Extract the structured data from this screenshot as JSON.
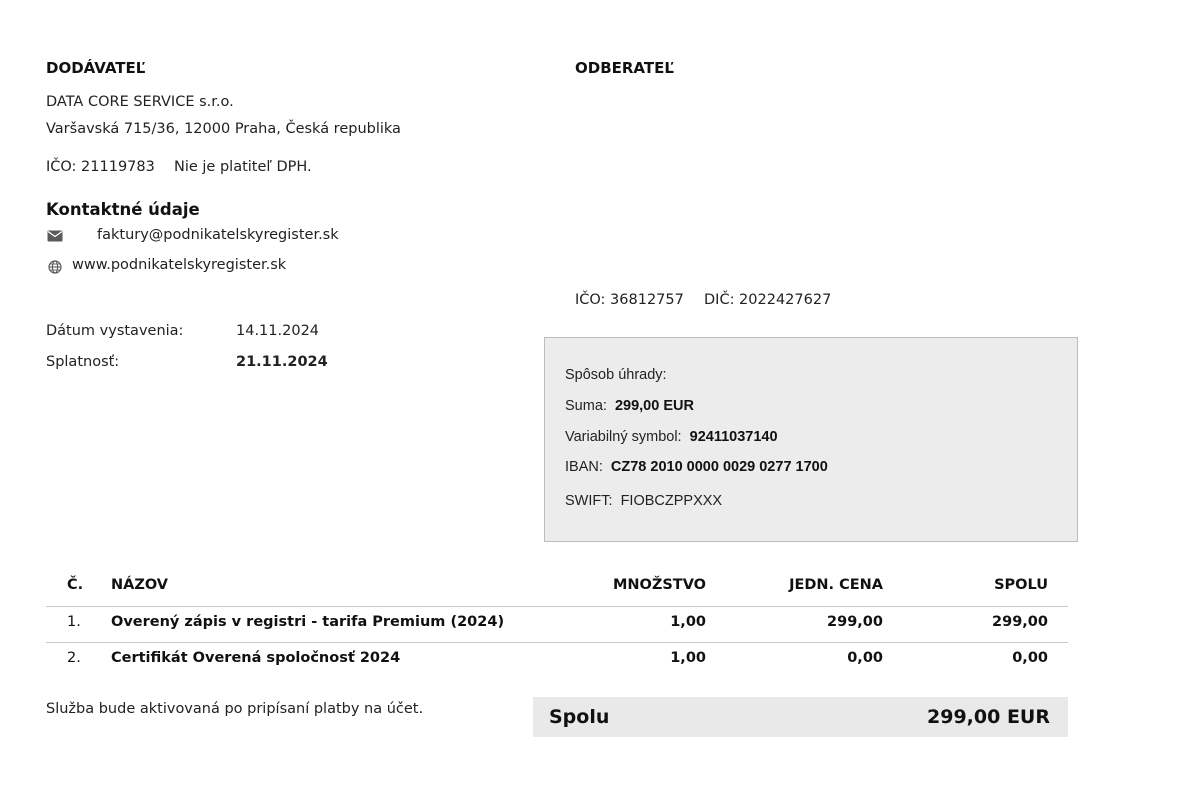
{
  "supplier": {
    "heading": "DODÁVATEĽ",
    "name": "DATA CORE SERVICE s.r.o.",
    "address": "Varšavská 715/36, 12000 Praha, Česká republika",
    "ico": "IČO: 21119783",
    "vat_status": "Nie je platiteľ DPH."
  },
  "contact": {
    "heading": "Kontaktné údaje",
    "email_icon": "envelope-icon",
    "email": "faktury@podnikatelskyregister.sk",
    "web_icon": "globe-icon",
    "web": "www.podnikatelskyregister.sk"
  },
  "customer": {
    "heading": "ODBERATEĽ",
    "ico": "IČO: 36812757",
    "dic": "DIČ: 2022427627"
  },
  "dates": {
    "issue_label": "Dátum vystavenia:",
    "issue_value": "14.11.2024",
    "due_label": "Splatnosť:",
    "due_value": "21.11.2024"
  },
  "payment": {
    "method_label": "Spôsob úhrady:",
    "method_value": "",
    "sum_label": "Suma:",
    "sum_value": "299,00 EUR",
    "vs_label": "Variabilný symbol:",
    "vs_value": "92411037140",
    "iban_label": "IBAN:",
    "iban_value": "CZ78 2010 0000 0029 0277 1700",
    "swift_label": "SWIFT:",
    "swift_value": "FIOBCZPPXXX"
  },
  "table": {
    "headers": {
      "no": "Č.",
      "name": "NÁZOV",
      "qty": "MNOŽSTVO",
      "unit_price": "JEDN. CENA",
      "total": "SPOLU"
    },
    "rows": [
      {
        "no": "1.",
        "name": "Overený zápis v registri - tarifa Premium (2024)",
        "qty": "1,00",
        "unit_price": "299,00",
        "total": "299,00"
      },
      {
        "no": "2.",
        "name": "Certifikát Overená spoločnosť 2024",
        "qty": "1,00",
        "unit_price": "0,00",
        "total": "0,00"
      }
    ]
  },
  "note": "Služba bude aktivovaná po pripísaní platby na účet.",
  "grand_total": {
    "label": "Spolu",
    "value": "299,00 EUR"
  }
}
